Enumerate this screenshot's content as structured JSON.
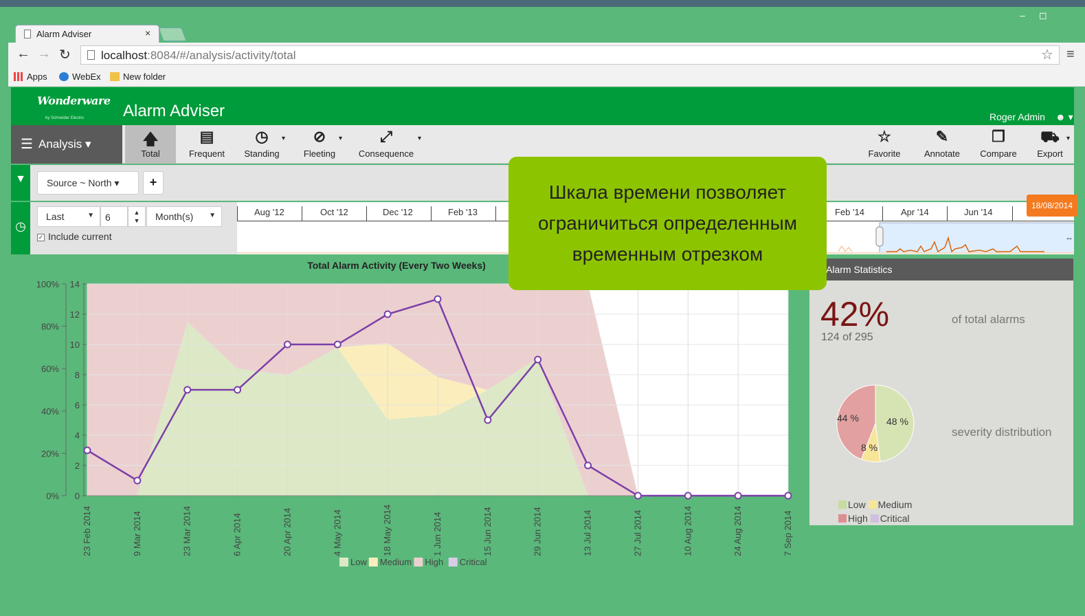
{
  "browser": {
    "tab_title": "Alarm Adviser",
    "tab_close": "×",
    "url_host": "localhost",
    "url_path": ":8084/#/analysis/activity/total",
    "bookmarks": [
      "Apps",
      "WebEx",
      "New folder"
    ]
  },
  "header": {
    "brand": "Wonderware",
    "brand_sub": "by Schneider Electric",
    "title": "Alarm Adviser",
    "user": "Roger Admin"
  },
  "toolbar": {
    "menu_label": "Analysis",
    "tools": [
      {
        "label": "Total",
        "icon": "arrow-up-icon",
        "active": true
      },
      {
        "label": "Frequent",
        "icon": "bar-chart-icon"
      },
      {
        "label": "Standing",
        "icon": "clock-icon"
      },
      {
        "label": "Fleeting",
        "icon": "eye-slash-icon"
      },
      {
        "label": "Consequence",
        "icon": "compress-icon"
      }
    ],
    "actions": [
      {
        "label": "Favorite",
        "icon": "star-icon"
      },
      {
        "label": "Annotate",
        "icon": "pencil-icon"
      },
      {
        "label": "Compare",
        "icon": "copy-icon"
      },
      {
        "label": "Export",
        "icon": "truck-icon"
      }
    ]
  },
  "filter": {
    "source": "Source ~ North",
    "add": "+"
  },
  "time": {
    "range_mode": "Last",
    "count": "6",
    "unit": "Month(s)",
    "include_current": "Include current",
    "timeline_labels": [
      "Aug '12",
      "Oct '12",
      "Dec '12",
      "Feb '13",
      "Feb '14",
      "Apr '14",
      "Jun '14"
    ],
    "end_date": "18/08/2014"
  },
  "callout": {
    "lines": [
      "Шкала времени позволяет",
      "ограничиться определенным",
      "временным отрезком"
    ]
  },
  "chart_data": {
    "type": "line",
    "title": "Total Alarm Activity (Every Two Weeks)",
    "categories": [
      "23 Feb 2014",
      "9 Mar 2014",
      "23 Mar 2014",
      "6 Apr 2014",
      "20 Apr 2014",
      "4 May 2014",
      "18 May 2014",
      "1 Jun 2014",
      "15 Jun 2014",
      "29 Jun 2014",
      "13 Jul 2014",
      "27 Jul 2014",
      "10 Aug 2014",
      "24 Aug 2014",
      "7 Sep 2014"
    ],
    "y_left_ticks": [
      "100%",
      "80%",
      "60%",
      "40%",
      "20%",
      "0%"
    ],
    "y_right": {
      "min": 0,
      "max": 14,
      "ticks": [
        "0",
        "2",
        "4",
        "6",
        "8",
        "10",
        "12",
        "14"
      ]
    },
    "series": [
      {
        "name": "Low",
        "kind": "stacked-percent",
        "color": "#dde8c6",
        "values": [
          0,
          0,
          82,
          60,
          57,
          70,
          36,
          38,
          50,
          65,
          0,
          0,
          0,
          0,
          0
        ]
      },
      {
        "name": "Medium",
        "kind": "stacked-percent",
        "color": "#fbeebc",
        "values": [
          0,
          0,
          0,
          0,
          0,
          0,
          36,
          18,
          0,
          0,
          0,
          0,
          0,
          0,
          0
        ]
      },
      {
        "name": "High",
        "kind": "stacked-percent",
        "color": "#ecd0d0",
        "values": [
          100,
          100,
          18,
          40,
          43,
          30,
          28,
          44,
          50,
          35,
          100,
          0,
          0,
          0,
          0
        ]
      },
      {
        "name": "Critical",
        "kind": "stacked-percent",
        "color": "#d8cce6",
        "values": [
          0,
          0,
          0,
          0,
          0,
          0,
          0,
          0,
          0,
          0,
          0,
          0,
          0,
          0,
          0
        ]
      },
      {
        "name": "Total",
        "kind": "line",
        "color": "#7b3fa8",
        "values": [
          3,
          1,
          7,
          7,
          10,
          10,
          12,
          13,
          5,
          9,
          2,
          0,
          0,
          0,
          0
        ]
      }
    ],
    "legend": [
      "Low",
      "Medium",
      "High",
      "Critical"
    ]
  },
  "stats": {
    "header": "al Alarm Statistics",
    "percent": "42%",
    "count": "124 of 295",
    "total_label": "of total alarms",
    "distribution_label": "severity distribution",
    "pie": [
      {
        "name": "Low",
        "value": 48,
        "label": "48 %",
        "color": "#d6e4b4"
      },
      {
        "name": "Medium",
        "value": 8,
        "label": "8 %",
        "color": "#f7e59a"
      },
      {
        "name": "High",
        "value": 44,
        "label": "44 %",
        "color": "#e3a0a0"
      }
    ],
    "legend": [
      {
        "name": "Low",
        "color": "#c7dca0"
      },
      {
        "name": "Medium",
        "color": "#f7e59a"
      },
      {
        "name": "High",
        "color": "#dc8f8f"
      },
      {
        "name": "Critical",
        "color": "#cfc0e0"
      }
    ]
  }
}
